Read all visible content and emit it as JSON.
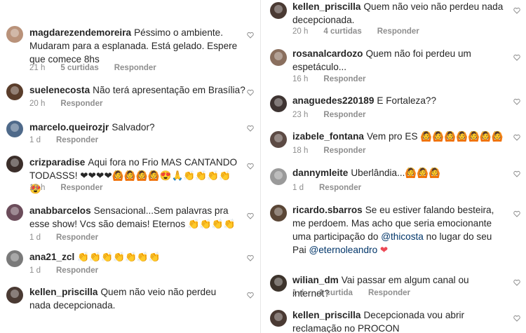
{
  "left": [
    {
      "user": "magdarezendemoreira",
      "text": "Péssimo o ambiente. Mudaram para a esplanada. Está gelado. Espere que comece 8hs",
      "time": "21 h",
      "likes": "5 curtidas",
      "reply": "Responder",
      "avatar_color": "#b9927a"
    },
    {
      "user": "suelenecosta",
      "text": "Não terá apresentação em Brasília?",
      "time": "20 h",
      "likes": "",
      "reply": "Responder",
      "avatar_color": "#5a3d2b"
    },
    {
      "user": "marcelo.queirozjr",
      "text": "Salvador?",
      "time": "1 d",
      "likes": "",
      "reply": "Responder",
      "avatar_color": "#4f6a8a"
    },
    {
      "user": "crizparadise",
      "text": "Aqui fora no Frio MAS CANTANDO TODASSS! ❤❤❤❤🙆🙆🙆🙆😍🙏👏👏👏👏😍",
      "time": "19 h",
      "likes": "",
      "reply": "Responder",
      "avatar_color": "#3b2e2a"
    },
    {
      "user": "anabbarcelos",
      "text": "Sensacional...Sem palavras pra esse show! Vcs são demais! Eternos 👏👏👏👏",
      "time": "1 d",
      "likes": "",
      "reply": "Responder",
      "avatar_color": "#6b4c5a"
    },
    {
      "user": "ana21_zcl",
      "text": "👏👏👏👏👏👏👏",
      "time": "1 d",
      "likes": "",
      "reply": "Responder",
      "avatar_color": "#7a7a7a"
    },
    {
      "user": "kellen_priscilla",
      "text": "Quem não veio não perdeu nada decepcionada.",
      "time": "",
      "likes": "",
      "reply": "",
      "avatar_color": "#4a3a33"
    }
  ],
  "right": [
    {
      "user": "kellen_priscilla",
      "text": "Quem não veio não perdeu nada decepcionada.",
      "time": "20 h",
      "likes": "4 curtidas",
      "reply": "Responder",
      "avatar_color": "#4a3a33"
    },
    {
      "user": "rosanalcardozo",
      "text": "Quem não foi perdeu um espetáculo...",
      "time": "16 h",
      "likes": "",
      "reply": "Responder",
      "avatar_color": "#8a6f5e"
    },
    {
      "user": "anaguedes220189",
      "text": "E Fortaleza??",
      "time": "23 h",
      "likes": "",
      "reply": "Responder",
      "avatar_color": "#3e3432"
    },
    {
      "user": "izabele_fontana",
      "text": "Vem pro ES 🙆🙆🙆🙆🙆🙆🙆",
      "time": "18 h",
      "likes": "",
      "reply": "Responder",
      "avatar_color": "#5c4a44"
    },
    {
      "user": "dannymleite",
      "text": "Uberlândia...🙆🙆🙆",
      "time": "1 d",
      "likes": "",
      "reply": "Responder",
      "avatar_color": "#9a9a9a"
    },
    {
      "user": "ricardo.sbarros",
      "text_parts": [
        "Se eu estiver falando besteira, me perdoem. Mas acho que seria emocionante uma participação do ",
        "@thicosta",
        " no lugar do seu Pai ",
        "@eternoleandro",
        " ❤"
      ],
      "time": "1 d",
      "likes": "",
      "reply": "Responder",
      "avatar_color": "#5a4636"
    },
    {
      "user": "wilian_dm",
      "text": "Vai passar em algum canal ou internet?",
      "time": "1 d",
      "likes": "1 curtida",
      "reply": "Responder",
      "avatar_color": "#3d342c"
    },
    {
      "user": "kellen_priscilla",
      "text": "Decepcionada vou abrir reclamação no PROCON",
      "time": "",
      "likes": "",
      "reply": "",
      "avatar_color": "#4a3a33"
    }
  ],
  "colors": {
    "mention": "#003569",
    "heart_red": "#ed4956",
    "meta": "#8e8e8e"
  }
}
